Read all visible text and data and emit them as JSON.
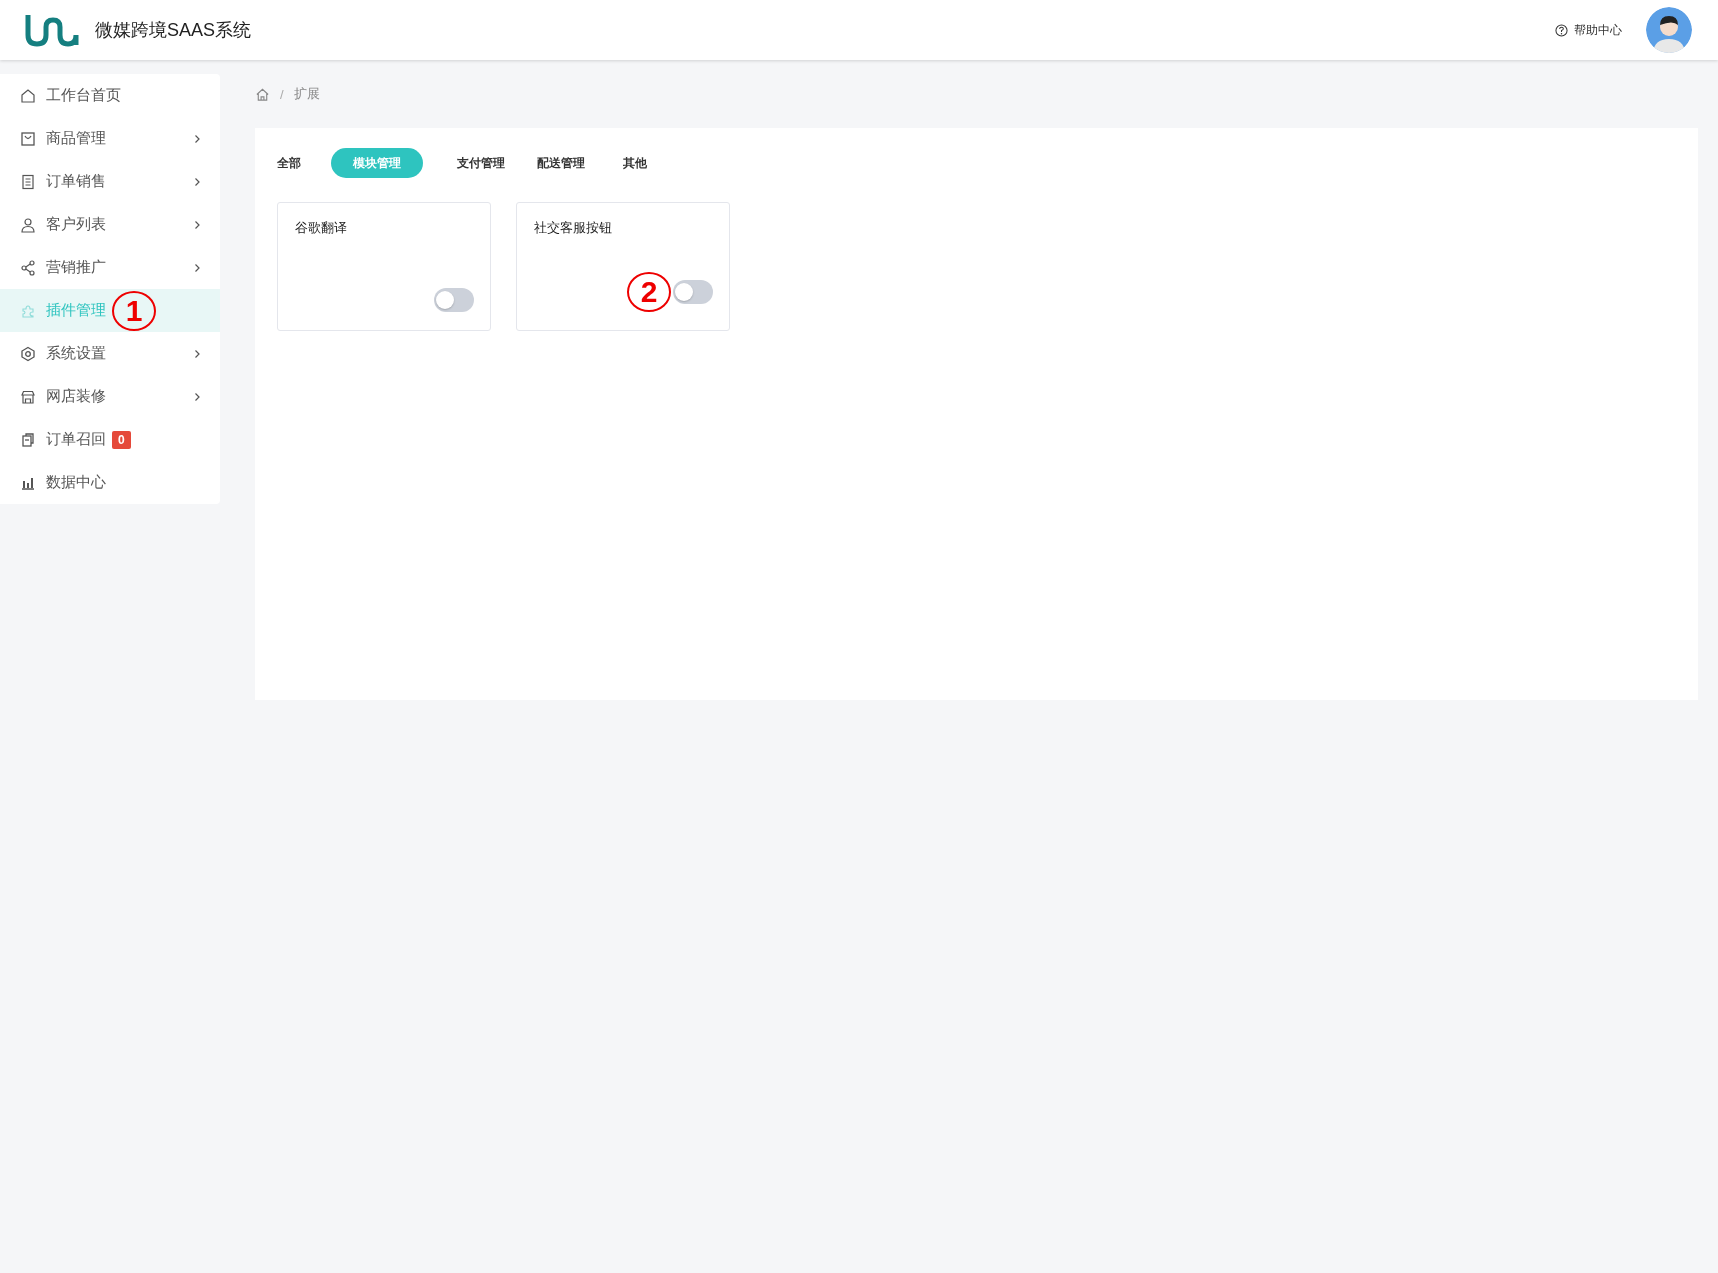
{
  "header": {
    "title": "微媒跨境SAAS系统",
    "help": "帮助中心"
  },
  "sidebar": {
    "items": [
      {
        "label": "工作台首页",
        "has_submenu": false,
        "selected": false
      },
      {
        "label": "商品管理",
        "has_submenu": true,
        "selected": false
      },
      {
        "label": "订单销售",
        "has_submenu": true,
        "selected": false
      },
      {
        "label": "客户列表",
        "has_submenu": true,
        "selected": false
      },
      {
        "label": "营销推广",
        "has_submenu": true,
        "selected": false
      },
      {
        "label": "插件管理",
        "has_submenu": false,
        "selected": true,
        "callout": "1"
      },
      {
        "label": "系统设置",
        "has_submenu": true,
        "selected": false
      },
      {
        "label": "网店装修",
        "has_submenu": true,
        "selected": false
      },
      {
        "label": "订单召回",
        "has_submenu": false,
        "selected": false,
        "badge": "0"
      },
      {
        "label": "数据中心",
        "has_submenu": false,
        "selected": false
      }
    ]
  },
  "breadcrumb": {
    "separator": "/",
    "items": [
      "扩展"
    ]
  },
  "tabs": [
    {
      "label": "全部",
      "selected": false
    },
    {
      "label": "模块管理",
      "selected": true
    },
    {
      "label": "支付管理",
      "selected": false
    },
    {
      "label": "配送管理",
      "selected": false
    },
    {
      "label": "其他",
      "selected": false
    }
  ],
  "cards": [
    {
      "title": "谷歌翻译",
      "on": false
    },
    {
      "title": "社交客服按钮",
      "on": false,
      "callout": "2"
    }
  ]
}
